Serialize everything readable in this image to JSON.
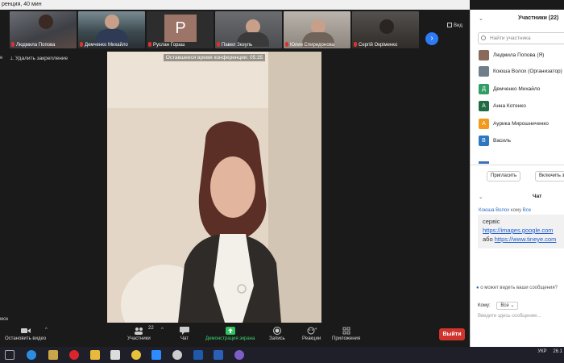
{
  "window": {
    "title": "ренция, 40 мин"
  },
  "gallery": {
    "tiles": [
      {
        "name": "Людмила Попова",
        "muted": true
      },
      {
        "name": "Демченко Михайло",
        "muted": true
      },
      {
        "name": "Руслан Гораш",
        "muted": true,
        "initial": "P"
      },
      {
        "name": "Павел Зезуль",
        "muted": true
      },
      {
        "name": "Юлия Спиридонова",
        "muted": true
      },
      {
        "name": "Сергій Окріменко",
        "muted": true
      }
    ],
    "view_label": "Вид"
  },
  "stage": {
    "unpin_label": "Удалить закрепление",
    "left_edge_label": "е",
    "left_edge_bottom": "мок",
    "timer_label": "Оставшееся время конференции: 05:35"
  },
  "controls": {
    "stop_video": "Остановить видео",
    "participants": "Участники",
    "participants_count": "22",
    "chat": "Чат",
    "share": "Демонстрация экрана",
    "record": "Запись",
    "reactions": "Реакции",
    "apps": "Приложения",
    "leave": "Выйти"
  },
  "participants_panel": {
    "title": "Участники (22)",
    "search_placeholder": "Найти участника",
    "list": [
      {
        "name": "Людмила Попова (Я)",
        "avatar": "photo",
        "color": "#8a6a5a"
      },
      {
        "name": "Коюша Волох (Организатор)",
        "avatar": "photo",
        "color": "#6f7f8a"
      },
      {
        "name": "Демченко Михайло",
        "avatar": "Д",
        "color": "#2f9e63"
      },
      {
        "name": "Анна Котенко",
        "avatar": "А",
        "color": "#1f6b43"
      },
      {
        "name": "Аурика Мирошниченко",
        "avatar": "А",
        "color": "#f39a1c"
      },
      {
        "name": "Василь",
        "avatar": "В",
        "color": "#2e78c2"
      }
    ],
    "invite_label": "Пригласить",
    "unmute_label": "Включить з"
  },
  "chat_panel": {
    "title": "Чат",
    "sender": "Коюша Волох",
    "to_word": "кому",
    "recipient": "Все",
    "message_line1": "сервіс",
    "link1": "https://images.google.com",
    "or_word": "або",
    "link2": "https://www.tineye.com",
    "who_can_see": "о может видеть ваши сообщения?",
    "to_label": "Кому:",
    "to_value": "Все",
    "input_placeholder": "Введите здесь сообщение..."
  },
  "taskbar": {
    "lang": "УКР",
    "time": "26.1"
  }
}
